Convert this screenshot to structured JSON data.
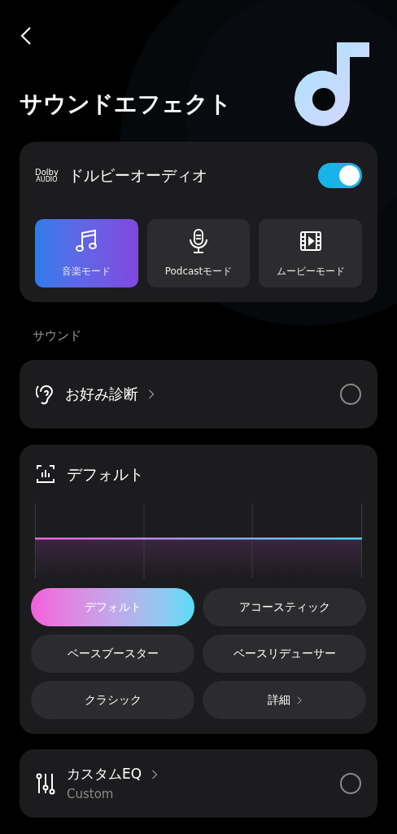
{
  "header": {
    "title": "サウンドエフェクト"
  },
  "dolby": {
    "logo_text": "Dolby",
    "logo_subtext": "AUDIO",
    "label": "ドルビーオーディオ",
    "on": true,
    "modes": [
      {
        "kind": "music",
        "label": "音楽モード",
        "selected": true
      },
      {
        "kind": "podcast",
        "label": "Podcastモード",
        "selected": false
      },
      {
        "kind": "movie",
        "label": "ムービーモード",
        "selected": false
      }
    ]
  },
  "section_label": "サウンド",
  "preference": {
    "label": "お好み診断",
    "selected": false
  },
  "eq_preset": {
    "title": "デフォルト",
    "presets": [
      {
        "kind": "preset",
        "label": "デフォルト",
        "selected": true
      },
      {
        "kind": "preset",
        "label": "アコースティック",
        "selected": false
      },
      {
        "kind": "preset",
        "label": "ベースブースター",
        "selected": false
      },
      {
        "kind": "preset",
        "label": "ベースリデューサー",
        "selected": false
      },
      {
        "kind": "preset",
        "label": "クラシック",
        "selected": false
      },
      {
        "kind": "more",
        "label": "詳細",
        "selected": false
      }
    ]
  },
  "custom_eq": {
    "title": "カスタムEQ",
    "subtitle": "Custom",
    "selected": false
  }
}
